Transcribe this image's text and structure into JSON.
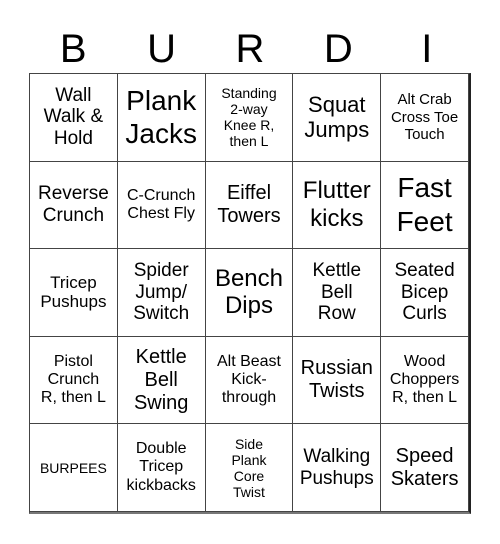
{
  "title_letters": [
    "B",
    "U",
    "R",
    "D",
    "I"
  ],
  "cells": [
    [
      "Wall\nWalk &\nHold",
      "Plank\nJacks",
      "Standing\n2-way\nKnee R,\nthen L",
      "Squat\nJumps",
      "Alt Crab\nCross Toe\nTouch"
    ],
    [
      "Reverse\nCrunch",
      "C-Crunch\nChest Fly",
      "Eiffel\nTowers",
      "Flutter\nkicks",
      "Fast\nFeet"
    ],
    [
      "Tricep\nPushups",
      "Spider\nJump/\nSwitch",
      "Bench\nDips",
      "Kettle\nBell\nRow",
      "Seated\nBicep\nCurls"
    ],
    [
      "Pistol\nCrunch\nR, then L",
      "Kettle\nBell\nSwing",
      "Alt Beast\nKick-\nthrough",
      "Russian\nTwists",
      "Wood\nChoppers\nR, then L"
    ],
    [
      "BURPEES",
      "Double\nTricep\nkickbacks",
      "Side\nPlank\nCore\nTwist",
      "Walking\nPushups",
      "Speed\nSkaters"
    ]
  ]
}
